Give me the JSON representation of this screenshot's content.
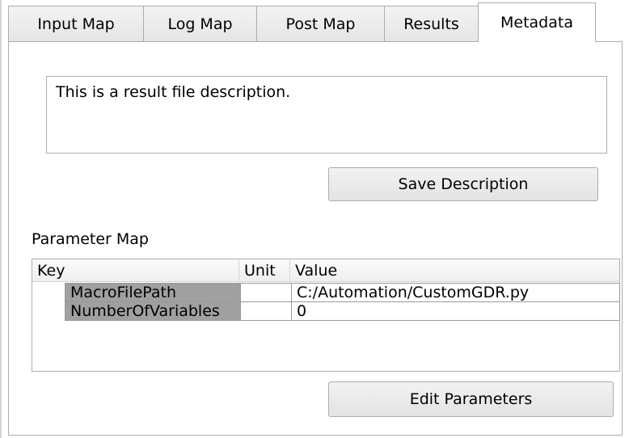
{
  "tabs": [
    {
      "label": "Input Map",
      "active": false
    },
    {
      "label": "Log Map",
      "active": false
    },
    {
      "label": "Post Map",
      "active": false
    },
    {
      "label": "Results",
      "active": false
    },
    {
      "label": "Metadata",
      "active": true
    }
  ],
  "description": {
    "text": "This is a result file description.",
    "save_label": "Save Description"
  },
  "parameters": {
    "section_label": "Parameter Map",
    "columns": [
      "Key",
      "Unit",
      "Value"
    ],
    "rows": [
      {
        "key": "MacroFilePath",
        "unit": "",
        "value": "C:/Automation/CustomGDR.py"
      },
      {
        "key": "NumberOfVariables",
        "unit": "",
        "value": "0"
      }
    ],
    "edit_label": "Edit Parameters"
  },
  "colors": {
    "key_cell_bg": "#a0a0a0",
    "border": "#adadad"
  }
}
